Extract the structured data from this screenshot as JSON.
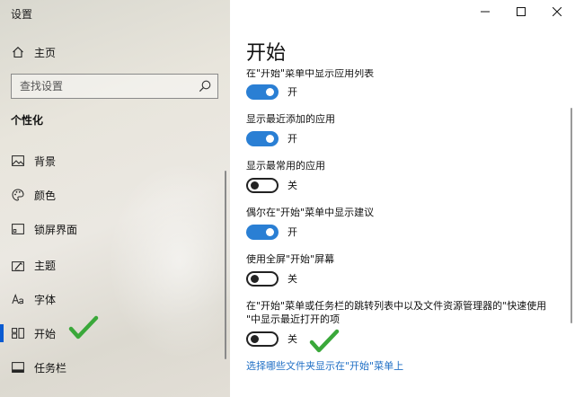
{
  "window": {
    "title": "设置"
  },
  "sidebar": {
    "home_label": "主页",
    "search": {
      "placeholder": "查找设置"
    },
    "section_title": "个性化",
    "items": [
      {
        "label": "背景",
        "icon": "image-icon"
      },
      {
        "label": "颜色",
        "icon": "palette-icon"
      },
      {
        "label": "锁屏界面",
        "icon": "lock-screen-icon"
      },
      {
        "label": "主题",
        "icon": "theme-icon"
      },
      {
        "label": "字体",
        "icon": "font-icon"
      },
      {
        "label": "开始",
        "icon": "start-icon",
        "selected": true
      },
      {
        "label": "任务栏",
        "icon": "taskbar-icon"
      }
    ]
  },
  "main": {
    "title": "开始",
    "options": [
      {
        "label": "在\"开始\"菜单中显示应用列表",
        "state": "开",
        "on": true
      },
      {
        "label": "显示最近添加的应用",
        "state": "开",
        "on": true
      },
      {
        "label": "显示最常用的应用",
        "state": "关",
        "on": false
      },
      {
        "label": "偶尔在\"开始\"菜单中显示建议",
        "state": "开",
        "on": true
      },
      {
        "label": "使用全屏\"开始\"屏幕",
        "state": "关",
        "on": false
      },
      {
        "label_line1": "在\"开始\"菜单或任务栏的跳转列表中以及文件资源管理器的\"快速使用",
        "label_line2": "\"中显示最近打开的项",
        "state": "关",
        "on": false
      }
    ],
    "link": "选择哪些文件夹显示在\"开始\"菜单上"
  },
  "colors": {
    "accent": "#0a5bd1",
    "toggle_on": "#2a7fd4",
    "link": "#1f6fc5",
    "check": "#3aa83a"
  }
}
